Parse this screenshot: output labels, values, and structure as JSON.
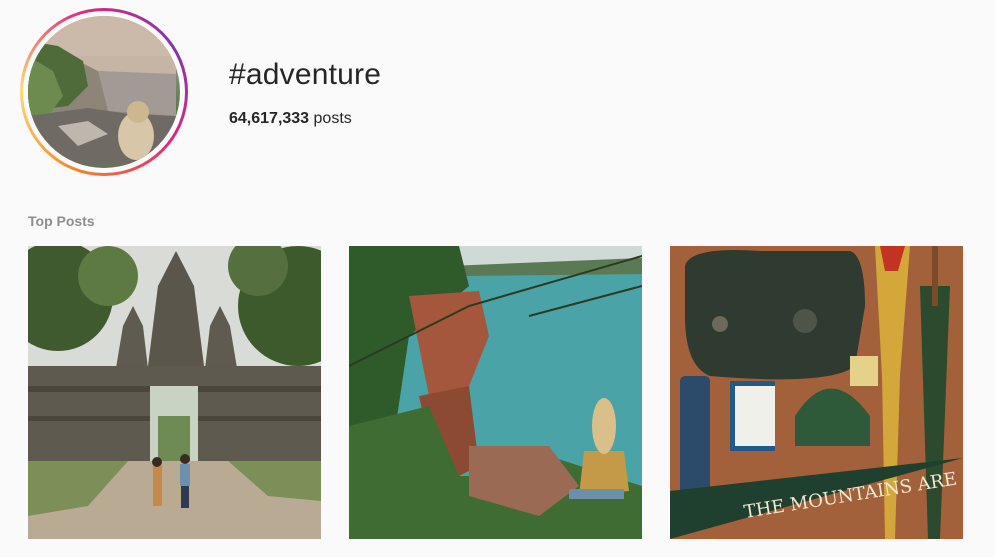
{
  "hashtag": {
    "title": "#adventure",
    "post_count": "64,617,333",
    "post_label": "posts"
  },
  "top_posts": {
    "label": "Top Posts",
    "items": [
      {
        "subject": "temple-gate-couple"
      },
      {
        "subject": "lake-cliff-person"
      },
      {
        "subject": "flatlay-gear-pennant",
        "pennant_text": "THE MOUNTAINS ARE CALLING"
      }
    ]
  },
  "colors": {
    "background": "#fafafa",
    "text": "#262626",
    "muted": "#8e8e8e",
    "ring_gradient": [
      "#f58529",
      "#feda77",
      "#dd2a7b",
      "#8134af"
    ]
  }
}
